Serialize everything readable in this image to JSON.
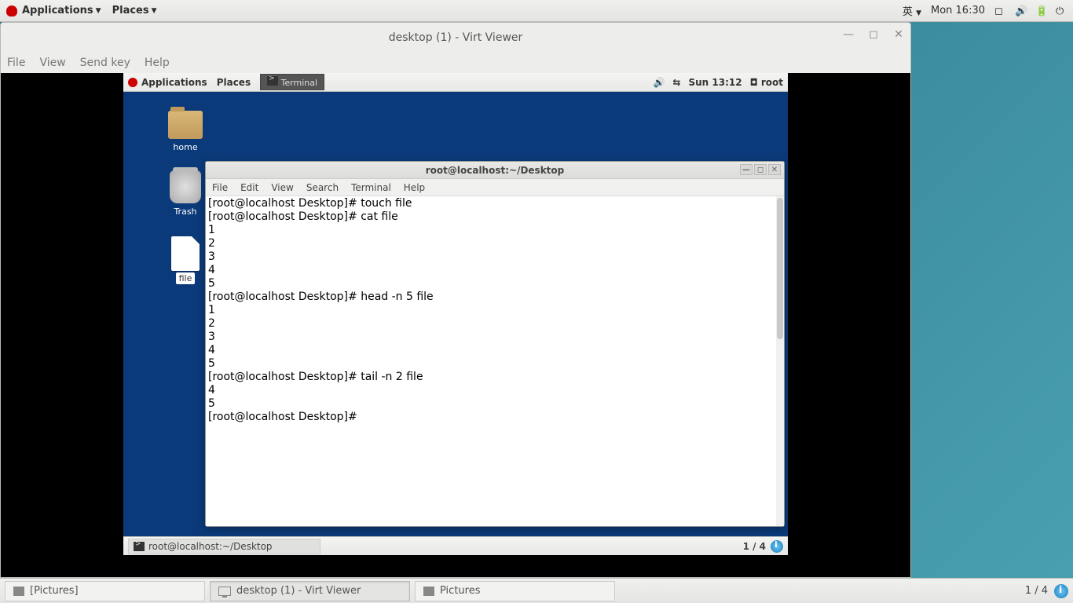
{
  "host": {
    "topbar": {
      "applications": "Applications",
      "places": "Places",
      "ime": "英",
      "clock": "Mon 16:30"
    },
    "taskbar": {
      "items": [
        {
          "label": "[Pictures]"
        },
        {
          "label": "desktop (1) - Virt Viewer"
        },
        {
          "label": "Pictures"
        }
      ],
      "workspace": "1 / 4"
    }
  },
  "virtviewer": {
    "title": "desktop (1) - Virt Viewer",
    "menus": [
      "File",
      "View",
      "Send key",
      "Help"
    ]
  },
  "guest": {
    "topbar": {
      "applications": "Applications",
      "places": "Places",
      "task_terminal": "Terminal",
      "clock": "Sun 13:12",
      "user": "root"
    },
    "desktop_icons": {
      "home": "home",
      "trash": "Trash",
      "file": "file"
    },
    "bottombar": {
      "task": "root@localhost:~/Desktop",
      "workspace": "1 / 4"
    }
  },
  "terminal": {
    "title": "root@localhost:~/Desktop",
    "menus": [
      "File",
      "Edit",
      "View",
      "Search",
      "Terminal",
      "Help"
    ],
    "lines": [
      "[root@localhost Desktop]# touch file",
      "[root@localhost Desktop]# cat file",
      "1",
      "2",
      "3",
      "4",
      "5",
      "[root@localhost Desktop]# head -n 5 file",
      "1",
      "2",
      "3",
      "4",
      "5",
      "[root@localhost Desktop]# tail -n 2 file",
      "4",
      "5",
      "[root@localhost Desktop]# "
    ]
  }
}
